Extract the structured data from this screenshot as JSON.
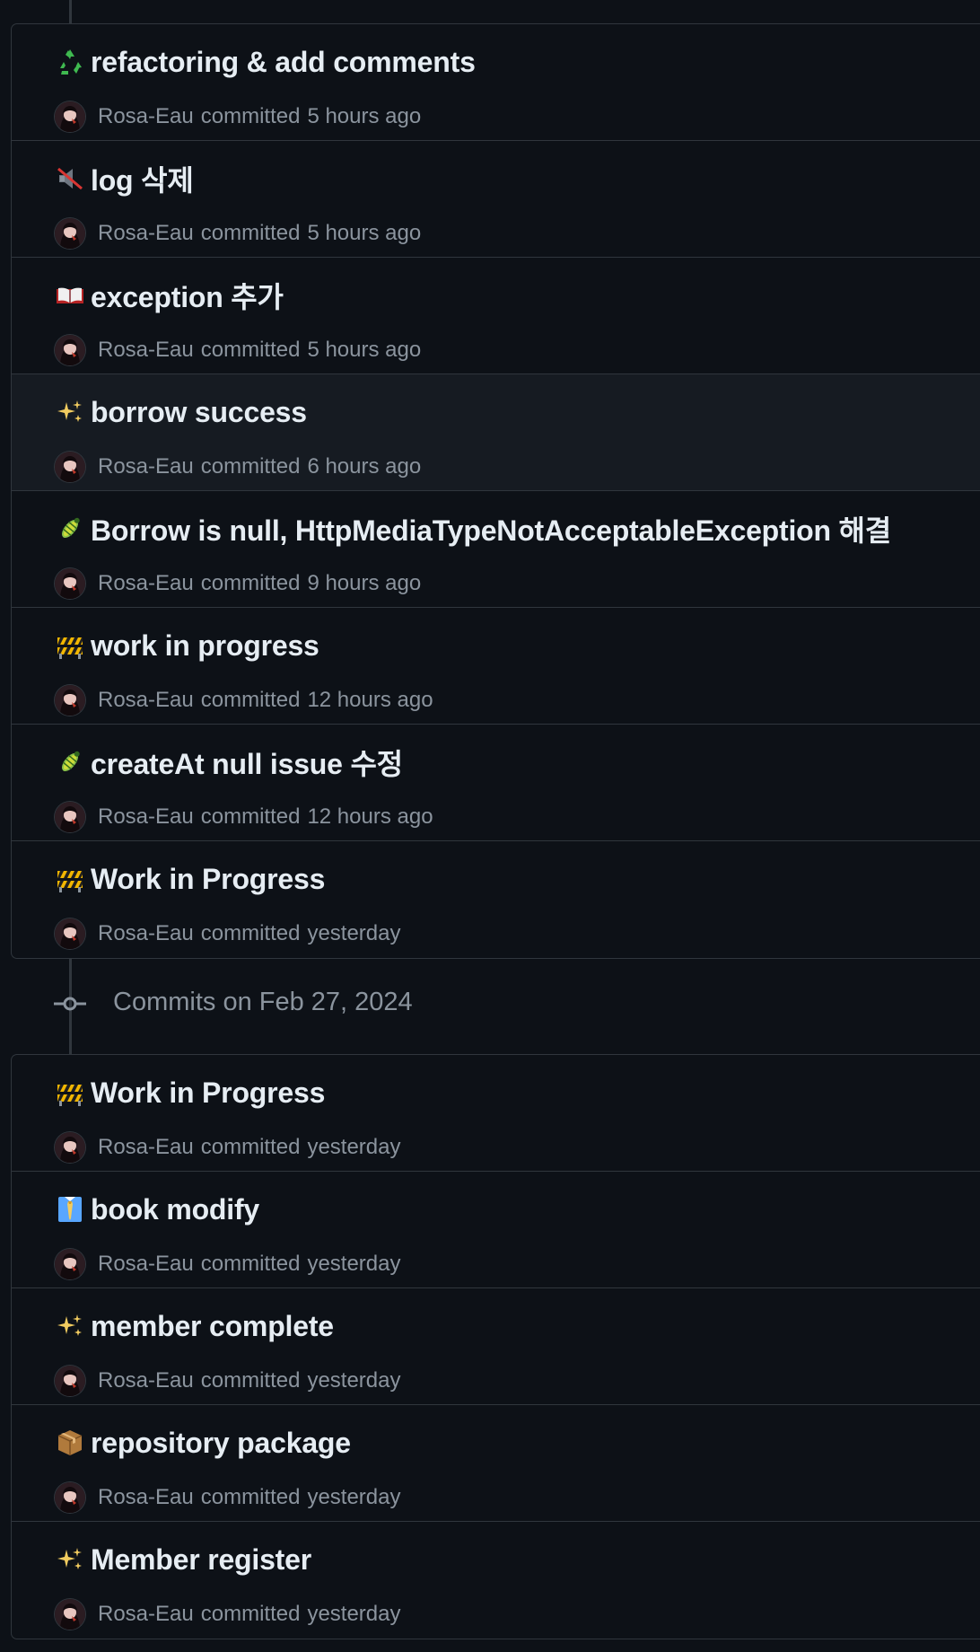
{
  "groups": [
    {
      "commits": [
        {
          "emoji": "recycle-icon",
          "title": "refactoring & add comments",
          "author": "Rosa-Eau",
          "action": "committed",
          "time": "5 hours ago"
        },
        {
          "emoji": "mute-speaker-icon",
          "title": "log 삭제",
          "author": "Rosa-Eau",
          "action": "committed",
          "time": "5 hours ago"
        },
        {
          "emoji": "open-book-icon",
          "title": "exception 추가",
          "author": "Rosa-Eau",
          "action": "committed",
          "time": "5 hours ago"
        },
        {
          "emoji": "sparkles-icon",
          "title": "borrow success",
          "author": "Rosa-Eau",
          "action": "committed",
          "time": "6 hours ago"
        },
        {
          "emoji": "bug-icon",
          "title": "Borrow is null, HttpMediaTypeNotAcceptableException 해결",
          "author": "Rosa-Eau",
          "action": "committed",
          "time": "9 hours ago"
        },
        {
          "emoji": "construction-icon",
          "title": "work in progress",
          "author": "Rosa-Eau",
          "action": "committed",
          "time": "12 hours ago"
        },
        {
          "emoji": "bug-icon",
          "title": "createAt null issue 수정",
          "author": "Rosa-Eau",
          "action": "committed",
          "time": "12 hours ago"
        },
        {
          "emoji": "construction-icon",
          "title": "Work in Progress",
          "author": "Rosa-Eau",
          "action": "committed",
          "time": "yesterday"
        }
      ]
    },
    {
      "date_label": "Commits on Feb 27, 2024",
      "commits": [
        {
          "emoji": "construction-icon",
          "title": "Work in Progress",
          "author": "Rosa-Eau",
          "action": "committed",
          "time": "yesterday"
        },
        {
          "emoji": "necktie-icon",
          "title": "book modify",
          "author": "Rosa-Eau",
          "action": "committed",
          "time": "yesterday"
        },
        {
          "emoji": "sparkles-icon",
          "title": "member complete",
          "author": "Rosa-Eau",
          "action": "committed",
          "time": "yesterday"
        },
        {
          "emoji": "package-icon",
          "title": "repository package",
          "author": "Rosa-Eau",
          "action": "committed",
          "time": "yesterday"
        },
        {
          "emoji": "sparkles-icon",
          "title": "Member register",
          "author": "Rosa-Eau",
          "action": "committed",
          "time": "yesterday"
        }
      ]
    }
  ],
  "colors": {
    "background": "#0d1117",
    "border": "#30363d",
    "text_primary": "#e6edf3",
    "text_muted": "#8b949e",
    "hover_row": "#161b22"
  }
}
